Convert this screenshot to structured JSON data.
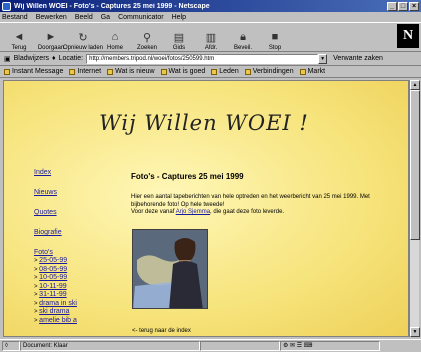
{
  "window": {
    "title": "Wij Willen WOEI - Foto's - Captures 25 mei 1999 - Netscape"
  },
  "menu": [
    "Bestand",
    "Bewerken",
    "Beeld",
    "Ga",
    "Communicator",
    "Help"
  ],
  "toolbar": [
    {
      "label": "Terug",
      "icon": "back-arrow-icon"
    },
    {
      "label": "Doorgaan",
      "icon": "forward-arrow-icon"
    },
    {
      "label": "Opnieuw laden",
      "icon": "reload-icon"
    },
    {
      "label": "Home",
      "icon": "home-icon"
    },
    {
      "label": "Zoeken",
      "icon": "search-icon"
    },
    {
      "label": "Gids",
      "icon": "guide-icon"
    },
    {
      "label": "Afdr.",
      "icon": "print-icon"
    },
    {
      "label": "Beveil.",
      "icon": "security-icon"
    },
    {
      "label": "Stop",
      "icon": "stop-icon"
    }
  ],
  "brand": "N",
  "address": {
    "bookmarks_label": "Bladwijzers",
    "location_label": "Locatie:",
    "url": "http://members.tripod.nl/woei/fotos/250599.htm",
    "related_label": "Verwante zaken"
  },
  "links": [
    "Instant Message",
    "Internet",
    "Wat is nieuw",
    "Wat is goed",
    "Leden",
    "Verbindingen",
    "Markt"
  ],
  "page": {
    "site_title": "Wij Willen WOEI !",
    "nav_main": [
      "Index",
      "Nieuws",
      "Quotes",
      "Biografie"
    ],
    "nav_fotos_label": "Foto's",
    "nav_fotos": [
      "25-05-99",
      "08-05-99",
      "10-05-99",
      "10-11-99",
      "31-11-99",
      "drama in ski",
      "ski drama",
      "amelie bib a"
    ],
    "heading": "Foto's - Captures 25 mei 1999",
    "para1": "Hier een aantal tapeberichten van hele optreden en het weerbericht van 25 mei 1999. Met bijbehorende foto! Op hele tweede!",
    "para2_pre": "Voor deze vanaf ",
    "para2_link": "Arjo Sjemma",
    "para2_post": ", die gaat deze foto leverde.",
    "back": "<- terug naar de index"
  },
  "status": {
    "text": "Document: Klaar"
  }
}
